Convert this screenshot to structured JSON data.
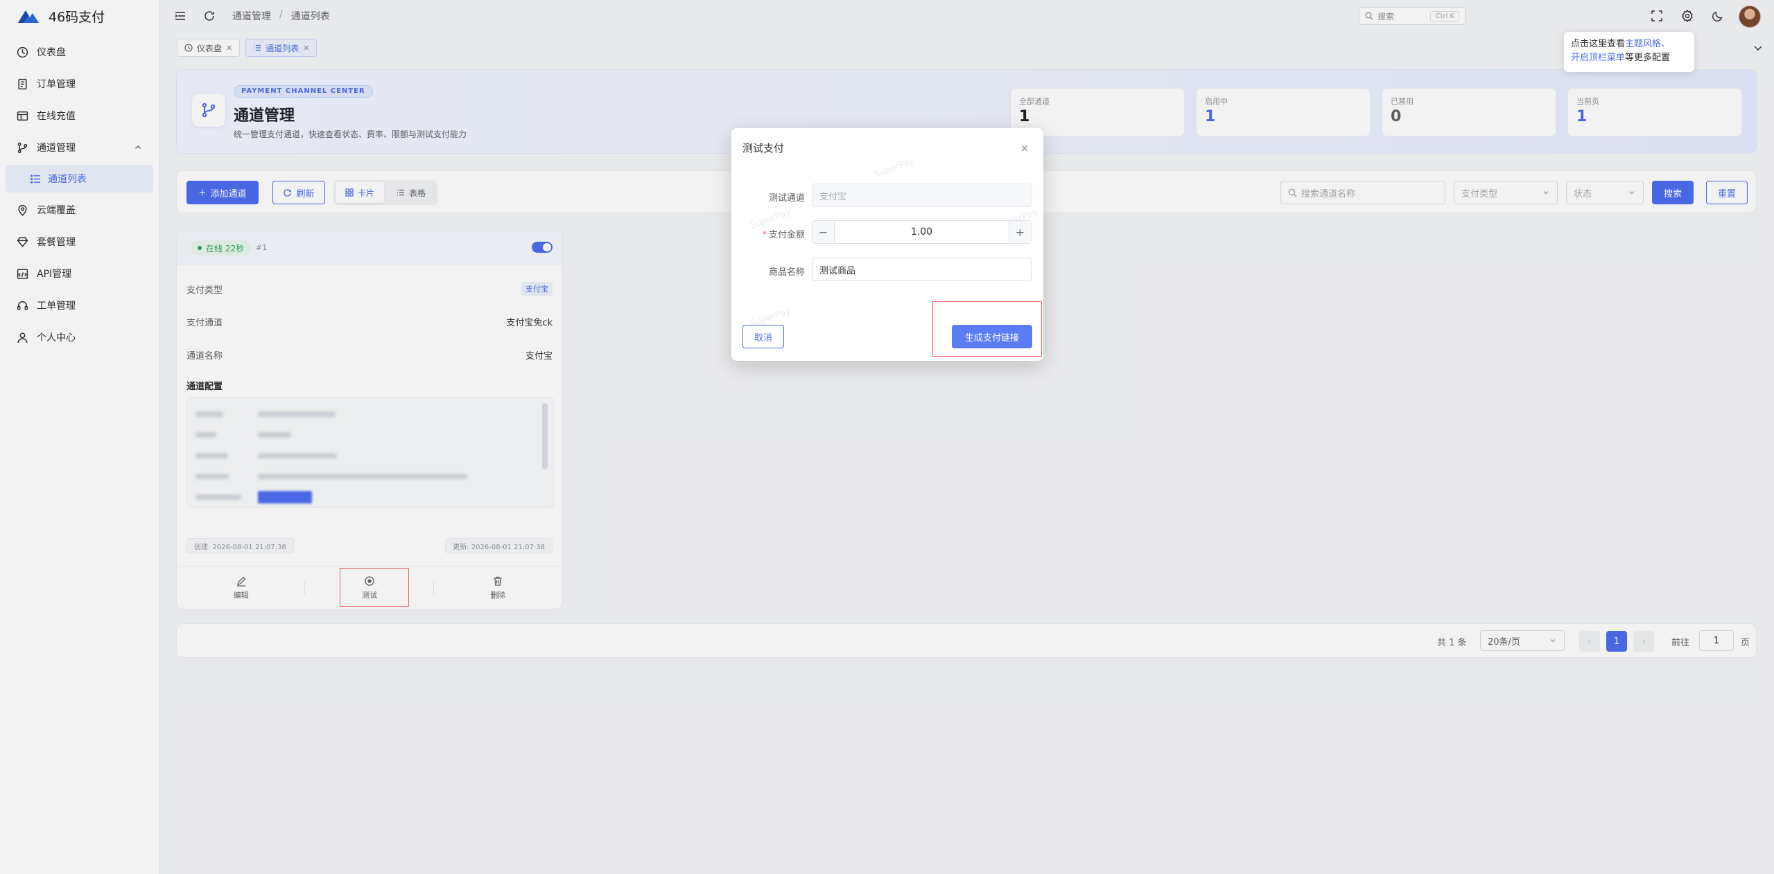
{
  "app": {
    "name": "46码支付"
  },
  "sidebar": {
    "items": [
      {
        "label": "仪表盘"
      },
      {
        "label": "订单管理"
      },
      {
        "label": "在线充值"
      },
      {
        "label": "通道管理"
      },
      {
        "label": "通道列表"
      },
      {
        "label": "云端覆盖"
      },
      {
        "label": "套餐管理"
      },
      {
        "label": "API管理"
      },
      {
        "label": "工单管理"
      },
      {
        "label": "个人中心"
      }
    ]
  },
  "header": {
    "breadcrumb": [
      "通道管理",
      "通道列表"
    ],
    "breadcrumb_sep": "/",
    "search_placeholder": "搜索",
    "search_kbd": "Ctrl K"
  },
  "tabs": [
    {
      "label": "仪表盘"
    },
    {
      "label": "通道列表"
    }
  ],
  "tooltip": {
    "prefix": "点击这里查看",
    "link1": "主题风格",
    "mid": "、",
    "link2": "开启顶栏菜单",
    "suffix": "等更多配置"
  },
  "banner": {
    "tag": "PAYMENT CHANNEL CENTER",
    "title": "通道管理",
    "subtitle": "统一管理支付通道，快速查看状态、费率、限额与测试支付能力",
    "stats": [
      {
        "label": "全部通道",
        "value": "1",
        "color": "#1f2329"
      },
      {
        "label": "启用中",
        "value": "1",
        "color": "#4d6df0"
      },
      {
        "label": "已禁用",
        "value": "0",
        "color": "#606266"
      },
      {
        "label": "当前页",
        "value": "1",
        "color": "#4d6df0"
      }
    ]
  },
  "toolbar": {
    "add_label": "添加通道",
    "refresh_label": "刷新",
    "view_card_label": "卡片",
    "view_table_label": "表格",
    "search_placeholder": "搜索通道名称",
    "pay_type_placeholder": "支付类型",
    "status_placeholder": "状态",
    "search_label": "搜索",
    "reset_label": "重置"
  },
  "card": {
    "status": "在线 22秒",
    "id": "#1",
    "rows": [
      {
        "label": "支付类型",
        "value": "支付宝"
      },
      {
        "label": "支付通道",
        "value": "支付宝免ck"
      },
      {
        "label": "通道名称",
        "value": "支付宝"
      }
    ],
    "config_title": "通道配置",
    "created": "创建: 2026-08-01 21:07:38",
    "updated": "更新: 2026-08-01 21:07:38",
    "actions": {
      "edit": "编辑",
      "test": "测试",
      "delete": "删除"
    }
  },
  "pagination": {
    "total": "共 1 条",
    "page_size": "20条/页",
    "current": "1",
    "goto_label": "前往",
    "goto_value": "1",
    "page_unit": "页"
  },
  "dialog": {
    "title": "测试支付",
    "channel_label": "测试通道",
    "channel_value": "支付宝",
    "amount_label": "支付金额",
    "amount_value": "1.00",
    "product_label": "商品名称",
    "product_value": "测试商品",
    "cancel_label": "取消",
    "generate_label": "生成支付链接",
    "watermark": "SuperPay"
  }
}
